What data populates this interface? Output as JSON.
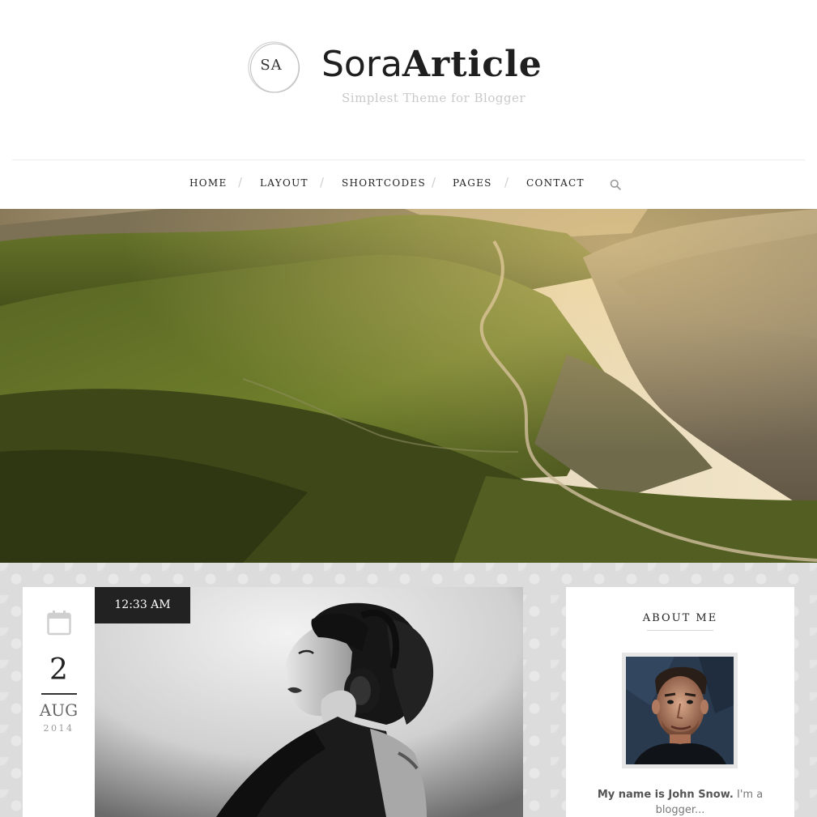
{
  "site": {
    "logo_monogram": "SA",
    "title_light": "Sora",
    "title_bold": "Article",
    "tagline": "Simplest Theme for Blogger"
  },
  "nav": {
    "items": [
      {
        "label": "HOME"
      },
      {
        "label": "LAYOUT"
      },
      {
        "label": "SHORTCODES"
      },
      {
        "label": "PAGES"
      },
      {
        "label": "CONTACT"
      }
    ],
    "separator": "/",
    "search_icon": "search-icon"
  },
  "post": {
    "time": "12:33 AM",
    "date_day": "2",
    "date_month": "AUG",
    "date_year": "2014",
    "calendar_icon": "calendar-icon"
  },
  "sidebar": {
    "about_title": "ABOUT ME",
    "about_text_bold": "My name is John Snow.",
    "about_text_rest": " I'm a blogger..."
  },
  "colors": {
    "background": "#ffffff",
    "content_background": "#dcdcdc",
    "text": "#222222",
    "muted": "#999999",
    "time_badge": "#222222"
  }
}
